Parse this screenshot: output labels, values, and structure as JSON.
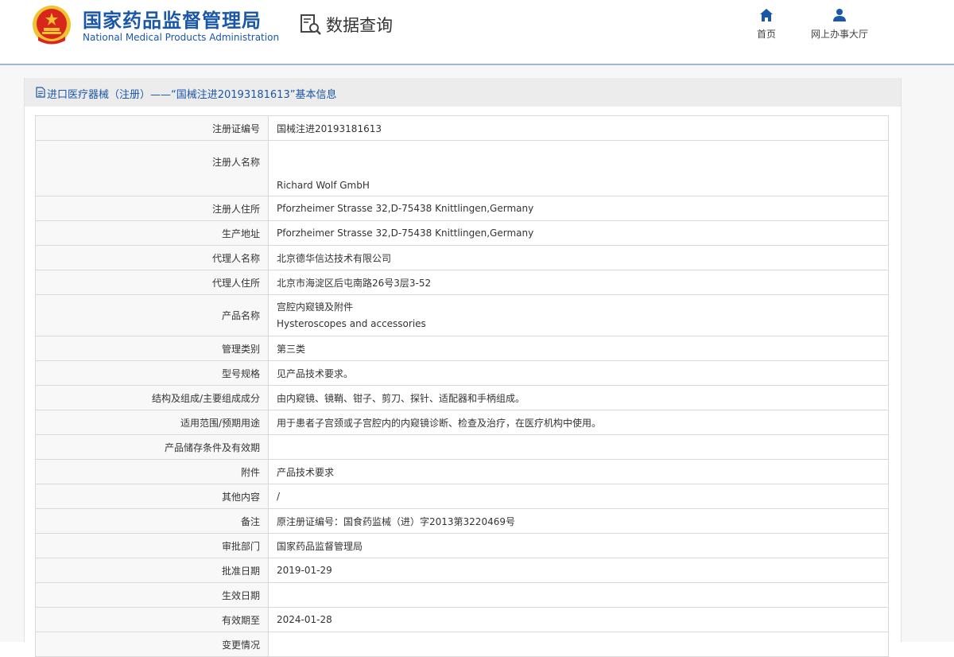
{
  "header": {
    "logo_cn": "国家药品监督管理局",
    "logo_en": "National Medical Products Administration",
    "section_title": "数据查询",
    "nav": [
      {
        "label": "首页",
        "icon": "home-icon"
      },
      {
        "label": "网上办事大厅",
        "icon": "user-icon"
      }
    ]
  },
  "panel": {
    "title": "进口医疗器械（注册）——“国械注进20193181613”基本信息"
  },
  "rows": [
    {
      "key": "注册证编号",
      "value": "国械注进20193181613"
    },
    {
      "key": "注册人名称",
      "value": "Richard Wolf GmbH"
    },
    {
      "key": "注册人住所",
      "value": "Pforzheimer Strasse 32,D-75438 Knittlingen,Germany"
    },
    {
      "key": "生产地址",
      "value": "Pforzheimer Strasse 32,D-75438 Knittlingen,Germany"
    },
    {
      "key": "代理人名称",
      "value": "北京德华信达技术有限公司"
    },
    {
      "key": "代理人住所",
      "value": "北京市海淀区后屯南路26号3层3-52"
    },
    {
      "key": "产品名称",
      "value": "宫腔内窥镜及附件",
      "value2": "Hysteroscopes and accessories"
    },
    {
      "key": "管理类别",
      "value": "第三类"
    },
    {
      "key": "型号规格",
      "value": "见产品技术要求。"
    },
    {
      "key": "结构及组成/主要组成成分",
      "value": "由内窥镜、镜鞘、钳子、剪刀、探针、适配器和手柄组成。"
    },
    {
      "key": "适用范围/预期用途",
      "value": "用于患者子宫颈或子宫腔内的内窥镜诊断、检查及治疗，在医疗机构中使用。"
    },
    {
      "key": "产品储存条件及有效期",
      "value": ""
    },
    {
      "key": "附件",
      "value": "产品技术要求"
    },
    {
      "key": "其他内容",
      "value": "/"
    },
    {
      "key": "备注",
      "value": "原注册证编号：国食药监械（进）字2013第3220469号"
    },
    {
      "key": "审批部门",
      "value": "国家药品监督管理局"
    },
    {
      "key": "批准日期",
      "value": "2019-01-29"
    },
    {
      "key": "生效日期",
      "value": ""
    },
    {
      "key": "有效期至",
      "value": "2024-01-28"
    },
    {
      "key": "变更情况",
      "value": ""
    }
  ],
  "colors": {
    "brand_blue": "#1a57a8",
    "emblem_red": "#d8261c",
    "emblem_gold": "#f2c230",
    "header_line": "#9cb7d8"
  }
}
